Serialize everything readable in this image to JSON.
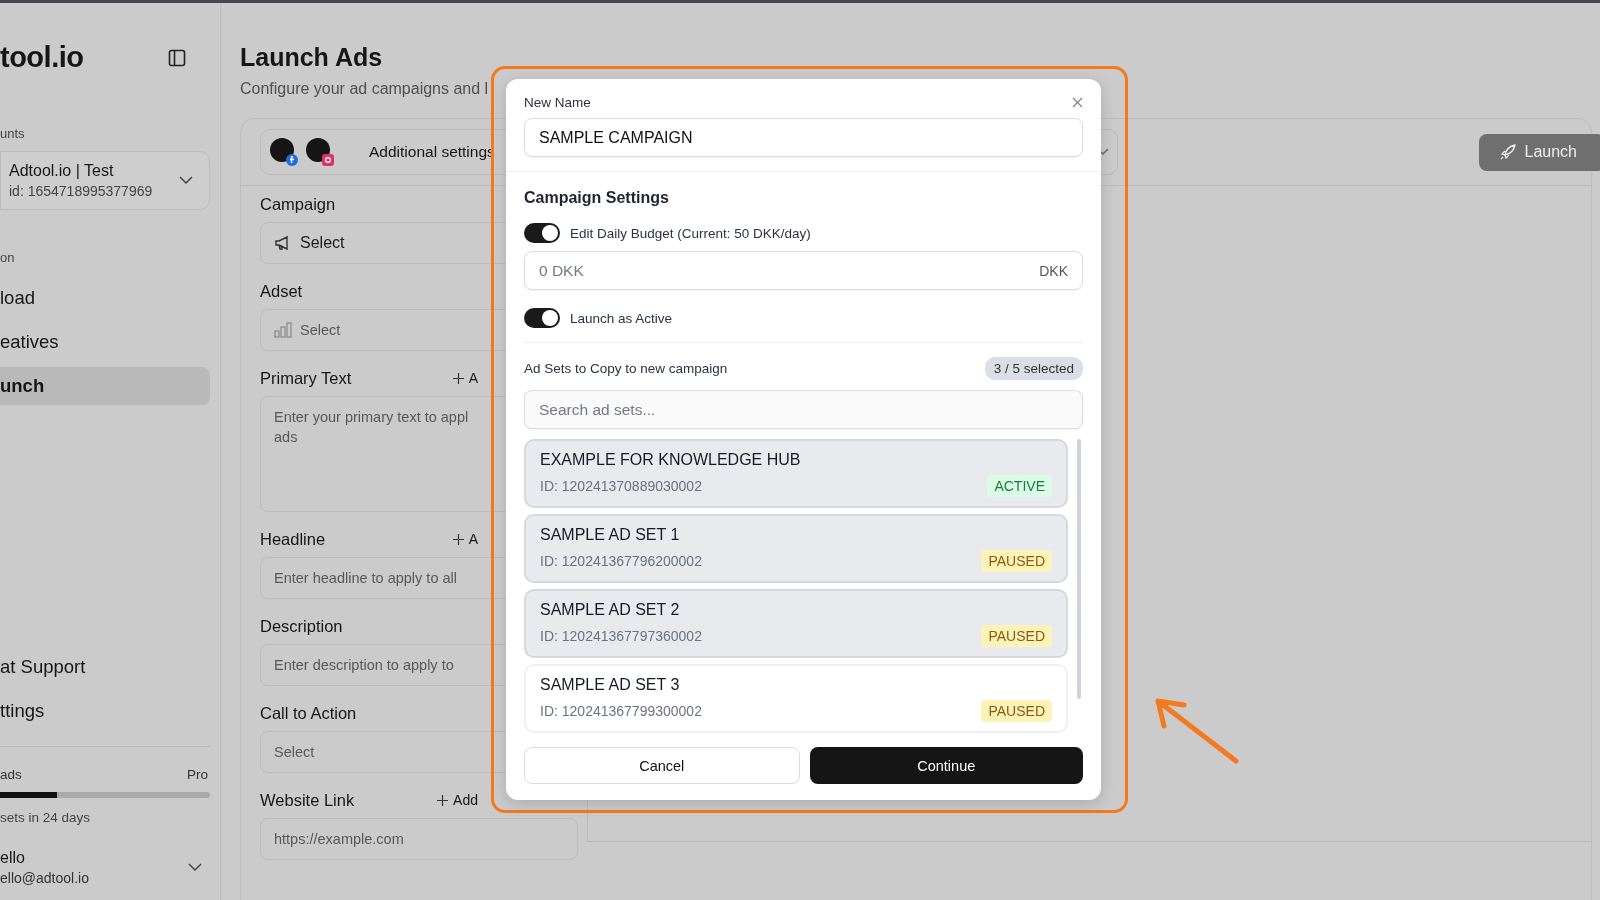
{
  "sidebar": {
    "logo": "tool.io",
    "accounts_label": "unts",
    "account": {
      "name": "Adtool.io | Test",
      "id": "id: 1654718995377969"
    },
    "section_label": "on",
    "nav": [
      {
        "label": "load",
        "selected": false
      },
      {
        "label": "eatives",
        "selected": false
      },
      {
        "label": "unch",
        "selected": true
      }
    ],
    "bottom_nav": [
      {
        "label": "at Support"
      },
      {
        "label": "ttings"
      }
    ],
    "usage": {
      "label": "ads",
      "plan": "Pro",
      "level": 0.27,
      "note": "sets in 24 days"
    },
    "user": {
      "name": "ello",
      "email": "ello@adtool.io"
    }
  },
  "page": {
    "title": "Launch Ads",
    "subtitle": "Configure your ad campaigns and l"
  },
  "form": {
    "settings_button": "Additional settings",
    "launch_button": "Launch",
    "fields": [
      {
        "label": "Campaign",
        "kind": "select",
        "value": "Select"
      },
      {
        "label": "Adset",
        "kind": "select",
        "placeholder": "Select"
      },
      {
        "label": "Primary Text",
        "kind": "textarea",
        "add": "A",
        "placeholder": "Enter your primary text to appl",
        "placeholder_2": "ads"
      },
      {
        "label": "Headline",
        "kind": "input",
        "add": "A",
        "placeholder": "Enter headline to apply to all"
      },
      {
        "label": "Description",
        "kind": "input",
        "placeholder": "Enter description to apply to"
      },
      {
        "label": "Call to Action",
        "kind": "select",
        "placeholder": "Select"
      },
      {
        "label": "Website Link",
        "kind": "wide-input",
        "add": "Add",
        "placeholder": "https://example.com"
      }
    ]
  },
  "modal": {
    "name_label": "New Name",
    "name_value": "SAMPLE CAMPAIGN",
    "section_title": "Campaign Settings",
    "toggles": [
      {
        "label": "Edit Daily Budget (Current: 50 DKK/day)",
        "on": true
      },
      {
        "label": "Launch as Active",
        "on": true
      }
    ],
    "budget": {
      "placeholder": "0 DKK",
      "suffix": "DKK"
    },
    "adsets_label": "Ad Sets to Copy to new campaign",
    "selected_count": "3 / 5 selected",
    "search_placeholder": "Search ad sets...",
    "adsets": [
      {
        "name": "EXAMPLE FOR KNOWLEDGE HUB",
        "id": "ID: 120241370889030002",
        "status": "ACTIVE",
        "kind": "active",
        "selected": true
      },
      {
        "name": "SAMPLE AD SET 1",
        "id": "ID: 120241367796200002",
        "status": "PAUSED",
        "kind": "paused",
        "selected": true
      },
      {
        "name": "SAMPLE AD SET 2",
        "id": "ID: 120241367797360002",
        "status": "PAUSED",
        "kind": "paused",
        "selected": true
      },
      {
        "name": "SAMPLE AD SET 3",
        "id": "ID: 120241367799300002",
        "status": "PAUSED",
        "kind": "paused",
        "selected": false
      }
    ],
    "cancel_button": "Cancel",
    "continue_button": "Continue"
  }
}
